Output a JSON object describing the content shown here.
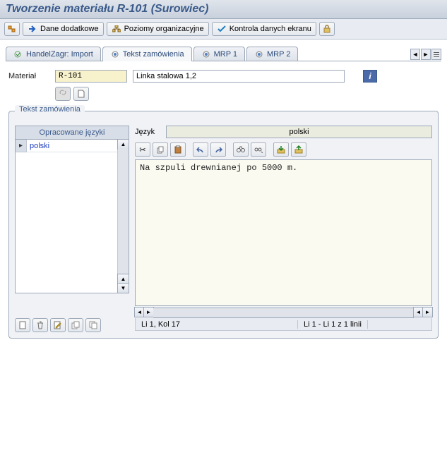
{
  "title": "Tworzenie materiału R-101 (Surowiec)",
  "toolbar": {
    "dane_dodatkowe": "Dane dodatkowe",
    "poziomy_org": "Poziomy organizacyjne",
    "kontrola": "Kontrola danych ekranu"
  },
  "tabs": {
    "handel": "HandelZagr: Import",
    "tekst": "Tekst zamówienia",
    "mrp1": "MRP 1",
    "mrp2": "MRP 2"
  },
  "form": {
    "material_label": "Materiał",
    "material_value": "R-101",
    "desc_value": "Linka stalowa 1,2"
  },
  "group": {
    "title": "Tekst zamówienia",
    "languages_header": "Opracowane języki",
    "lang_item": "polski",
    "lang_label": "Język",
    "lang_value": "polski",
    "editor_text": "Na szpuli drewnianej po 5000 m.",
    "status_pos": "Li 1, Kol 17",
    "status_range": "Li 1 - Li 1 z 1 linii"
  }
}
